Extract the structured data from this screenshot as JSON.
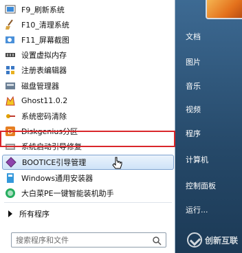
{
  "menu": {
    "items": [
      {
        "label": "F9_刷新系统",
        "icon": "refresh-icon"
      },
      {
        "label": "F10_清理系统",
        "icon": "broom-icon"
      },
      {
        "label": "F11_屏幕截图",
        "icon": "screenshot-icon"
      },
      {
        "label": "设置虚拟内存",
        "icon": "memory-chip-icon"
      },
      {
        "label": "注册表编辑器",
        "icon": "registry-icon"
      },
      {
        "label": "磁盘管理器",
        "icon": "disk-manager-icon"
      },
      {
        "label": "Ghost11.0.2",
        "icon": "ghost-icon"
      },
      {
        "label": "系统密码清除",
        "icon": "key-icon"
      },
      {
        "label": "Diskgenius分区",
        "icon": "diskgenius-icon"
      },
      {
        "label": "系统启动引导修复",
        "icon": "boot-repair-icon"
      },
      {
        "label": "BOOTICE引导管理",
        "icon": "bootice-icon"
      },
      {
        "label": "Windows通用安装器",
        "icon": "installer-icon"
      },
      {
        "label": "大白菜PE一键智能装机助手",
        "icon": "cabbage-icon"
      }
    ],
    "all_programs": "所有程序"
  },
  "search": {
    "placeholder": "搜索程序和文件"
  },
  "right_panel": {
    "links": [
      "文档",
      "图片",
      "音乐",
      "视频",
      "程序",
      "计算机",
      "控制面板",
      "运行..."
    ]
  },
  "watermark": {
    "text": "创新互联"
  }
}
